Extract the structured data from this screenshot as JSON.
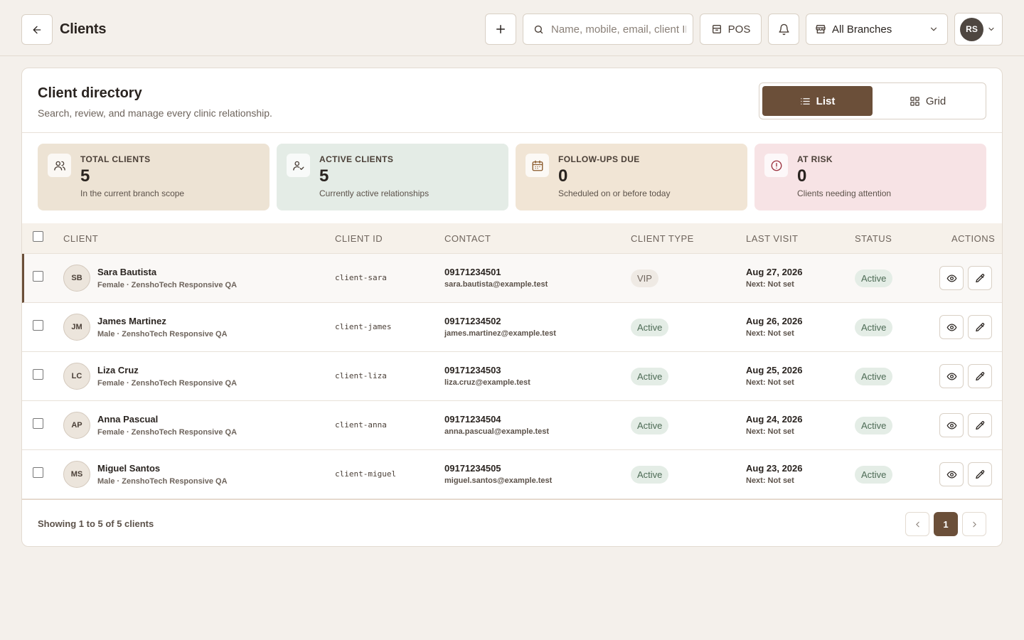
{
  "header": {
    "title": "Clients",
    "search_placeholder": "Name, mobile, email, client ID",
    "pos_label": "POS",
    "branch_label": "All Branches",
    "user_initials": "RS"
  },
  "directory": {
    "title": "Client directory",
    "subtitle": "Search, review, and manage every clinic relationship.",
    "view_list": "List",
    "view_grid": "Grid",
    "active_view": "List"
  },
  "stats": [
    {
      "label": "TOTAL CLIENTS",
      "value": "5",
      "desc": "In the current branch scope",
      "icon": "users-icon",
      "bg": "#ede3d4"
    },
    {
      "label": "ACTIVE CLIENTS",
      "value": "5",
      "desc": "Currently active relationships",
      "icon": "user-check-icon",
      "bg": "#e4ece6"
    },
    {
      "label": "FOLLOW-UPS DUE",
      "value": "0",
      "desc": "Scheduled on or before today",
      "icon": "calendar-icon",
      "bg": "#f1e5d5"
    },
    {
      "label": "AT RISK",
      "value": "0",
      "desc": "Clients needing attention",
      "icon": "alert-circle-icon",
      "bg": "#f7e3e5"
    }
  ],
  "table": {
    "columns": [
      "CLIENT",
      "CLIENT ID",
      "CONTACT",
      "CLIENT TYPE",
      "LAST VISIT",
      "STATUS",
      "ACTIONS"
    ],
    "rows": [
      {
        "initials": "SB",
        "name": "Sara Bautista",
        "meta": "Female · ZenshoTech Responsive QA",
        "client_id": "client-sara",
        "phone": "09171234501",
        "email": "sara.bautista@example.test",
        "type": "VIP",
        "last_visit": "Aug 27, 2026",
        "next": "Next: Not set",
        "status": "Active"
      },
      {
        "initials": "JM",
        "name": "James Martinez",
        "meta": "Male · ZenshoTech Responsive QA",
        "client_id": "client-james",
        "phone": "09171234502",
        "email": "james.martinez@example.test",
        "type": "Active",
        "last_visit": "Aug 26, 2026",
        "next": "Next: Not set",
        "status": "Active"
      },
      {
        "initials": "LC",
        "name": "Liza Cruz",
        "meta": "Female · ZenshoTech Responsive QA",
        "client_id": "client-liza",
        "phone": "09171234503",
        "email": "liza.cruz@example.test",
        "type": "Active",
        "last_visit": "Aug 25, 2026",
        "next": "Next: Not set",
        "status": "Active"
      },
      {
        "initials": "AP",
        "name": "Anna Pascual",
        "meta": "Female · ZenshoTech Responsive QA",
        "client_id": "client-anna",
        "phone": "09171234504",
        "email": "anna.pascual@example.test",
        "type": "Active",
        "last_visit": "Aug 24, 2026",
        "next": "Next: Not set",
        "status": "Active"
      },
      {
        "initials": "MS",
        "name": "Miguel Santos",
        "meta": "Male · ZenshoTech Responsive QA",
        "client_id": "client-miguel",
        "phone": "09171234505",
        "email": "miguel.santos@example.test",
        "type": "Active",
        "last_visit": "Aug 23, 2026",
        "next": "Next: Not set",
        "status": "Active"
      }
    ]
  },
  "footer": {
    "showing": "Showing 1 to 5 of 5 clients",
    "current_page": "1"
  },
  "colors": {
    "accent": "#6b4f39",
    "background": "#f4f0eb"
  }
}
